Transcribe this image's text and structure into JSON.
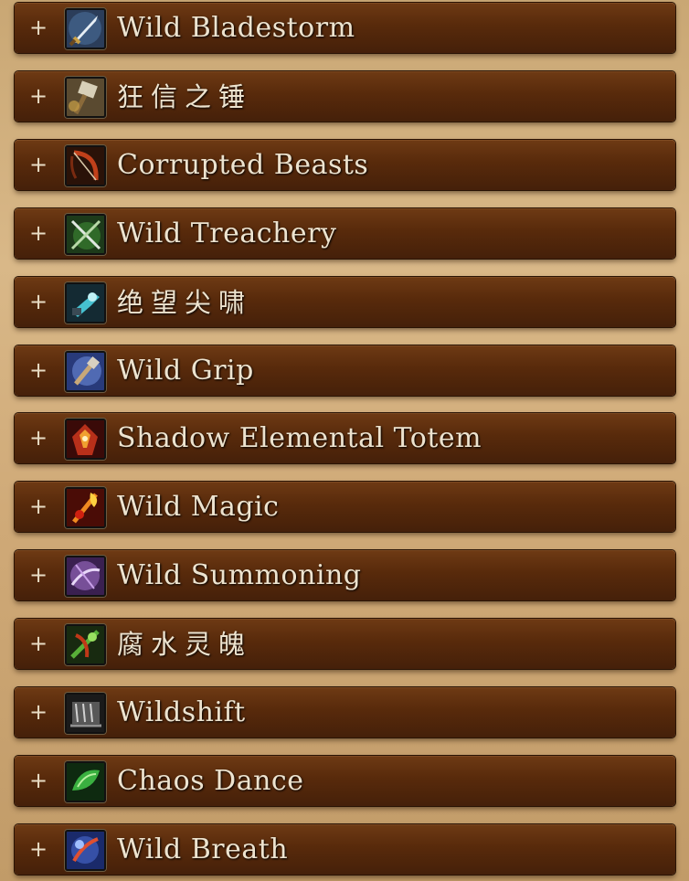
{
  "talents": [
    {
      "label": "Wild Bladestorm",
      "icon": "sword-icon"
    },
    {
      "label": "狂信之锤",
      "icon": "hammer-icon"
    },
    {
      "label": "Corrupted Beasts",
      "icon": "bow-icon"
    },
    {
      "label": "Wild Treachery",
      "icon": "crossed-weapons-icon"
    },
    {
      "label": "绝望尖啸",
      "icon": "scream-icon"
    },
    {
      "label": "Wild Grip",
      "icon": "mace-icon"
    },
    {
      "label": "Shadow Elemental Totem",
      "icon": "totem-icon"
    },
    {
      "label": "Wild Magic",
      "icon": "fire-staff-icon"
    },
    {
      "label": "Wild Summoning",
      "icon": "summon-icon"
    },
    {
      "label": "腐水灵魄",
      "icon": "poison-spirit-icon"
    },
    {
      "label": "Wildshift",
      "icon": "claw-icon"
    },
    {
      "label": "Chaos Dance",
      "icon": "green-swirl-icon"
    },
    {
      "label": "Wild Breath",
      "icon": "breath-icon"
    }
  ],
  "expand_symbol": "+"
}
